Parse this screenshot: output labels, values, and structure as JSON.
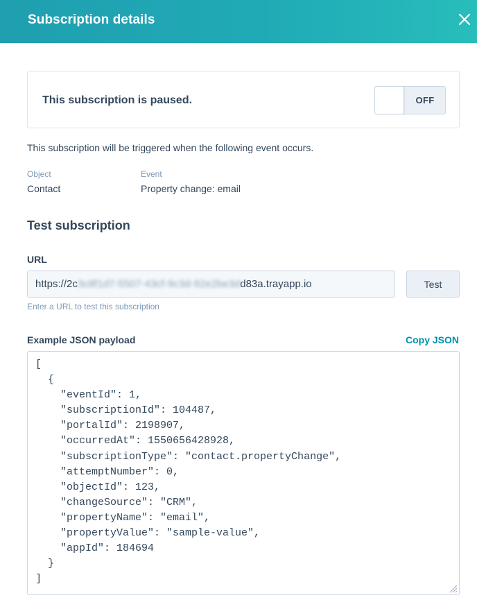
{
  "header": {
    "title": "Subscription details",
    "close_icon": "close-icon",
    "color_start": "#1f9fb0",
    "color_end": "#28bdbb"
  },
  "status": {
    "message": "This subscription is paused.",
    "toggle_label": "OFF"
  },
  "description": "This subscription will be triggered when the following event occurs.",
  "details": {
    "object_label": "Object",
    "object_value": "Contact",
    "event_label": "Event",
    "event_value": "Property change: email"
  },
  "test": {
    "title": "Test subscription",
    "url_label": "URL",
    "url_prefix": "https://2c",
    "url_redacted": "3c8f1d7-5507-43cf-9c3d-92e2be3d",
    "url_suffix": "d83a.trayapp.io",
    "test_button": "Test",
    "help": "Enter a URL to test this subscription"
  },
  "payload": {
    "label": "Example JSON payload",
    "copy_label": "Copy JSON",
    "json": "[\n  {\n    \"eventId\": 1,\n    \"subscriptionId\": 104487,\n    \"portalId\": 2198907,\n    \"occurredAt\": 1550656428928,\n    \"subscriptionType\": \"contact.propertyChange\",\n    \"attemptNumber\": 0,\n    \"objectId\": 123,\n    \"changeSource\": \"CRM\",\n    \"propertyName\": \"email\",\n    \"propertyValue\": \"sample-value\",\n    \"appId\": 184694\n  }\n]"
  },
  "colors": {
    "text": "#33475b",
    "muted": "#7c98b6",
    "link": "#0091ae",
    "border": "#cbd6e2"
  }
}
